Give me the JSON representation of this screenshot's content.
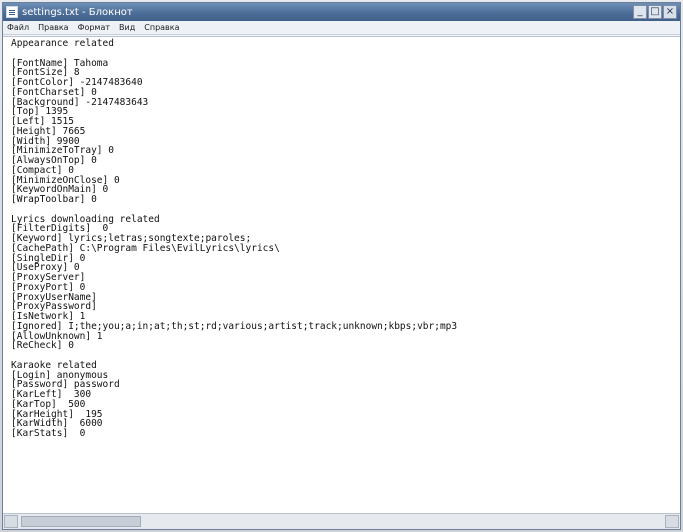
{
  "window": {
    "title": "settings.txt - Блокнот",
    "controls": {
      "minimize": "_",
      "maximize": "□",
      "close": "×"
    }
  },
  "menubar": {
    "items": [
      "Файл",
      "Правка",
      "Формат",
      "Вид",
      "Справка"
    ]
  },
  "document": {
    "lines": [
      "Appearance related",
      "",
      "[FontName] Tahoma",
      "[FontSize] 8",
      "[FontColor] -2147483640",
      "[FontCharset] 0",
      "[Background] -2147483643",
      "[Top] 1395",
      "[Left] 1515",
      "[Height] 7665",
      "[Width] 9900",
      "[MinimizeToTray] 0",
      "[AlwaysOnTop] 0",
      "[Compact] 0",
      "[MinimizeOnClose] 0",
      "[KeywordOnMain] 0",
      "[WrapToolbar] 0",
      "",
      "Lyrics downloading related",
      "[FilterDigits]  0",
      "[Keyword] lyrics;letras;songtexte;paroles;",
      "[CachePath] C:\\Program Files\\EvilLyrics\\lyrics\\",
      "[SingleDir] 0",
      "[UseProxy] 0",
      "[ProxyServer]",
      "[ProxyPort] 0",
      "[ProxyUserName]",
      "[ProxyPassword]",
      "[IsNetwork] 1",
      "[Ignored] I;the;you;a;in;at;th;st;rd;various;artist;track;unknown;kbps;vbr;mp3",
      "[AllowUnknown] 1",
      "[ReCheck] 0",
      "",
      "Karaoke related",
      "[Login] anonymous",
      "[Password] password",
      "[KarLeft]  300",
      "[KarTop]  500",
      "[KarHeight]  195",
      "[KarWidth]  6000",
      "[KarStats]  0"
    ]
  }
}
